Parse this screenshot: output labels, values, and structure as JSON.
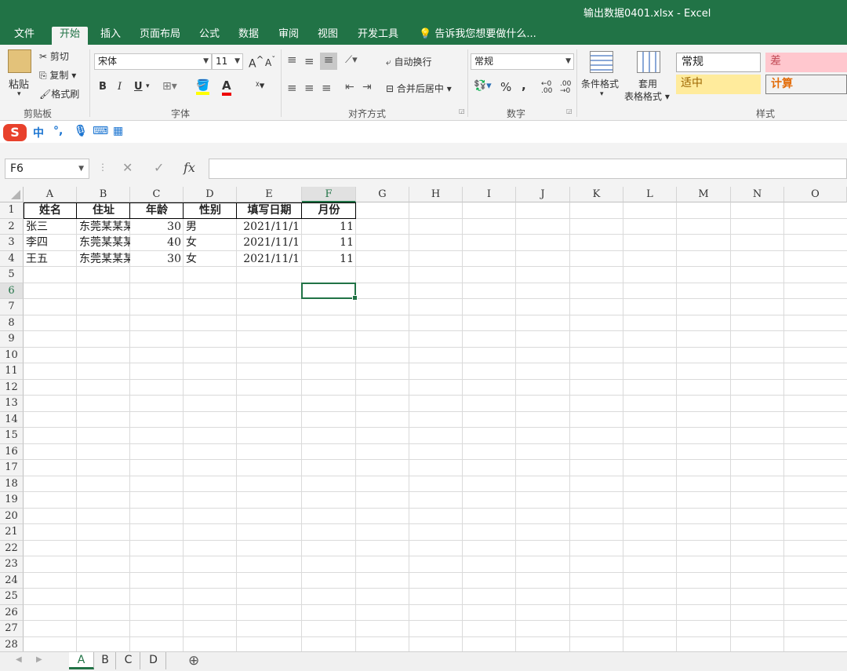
{
  "window": {
    "title": "输出数据0401.xlsx - Excel"
  },
  "tabs": [
    "文件",
    "开始",
    "插入",
    "页面布局",
    "公式",
    "数据",
    "审阅",
    "视图",
    "开发工具"
  ],
  "active_tab": "开始",
  "tell_me": "告诉我您想要做什么...",
  "ribbon": {
    "clipboard": {
      "paste": "粘贴",
      "cut": "剪切",
      "copy": "复制",
      "format_painter": "格式刷",
      "label": "剪贴板"
    },
    "font": {
      "name": "宋体",
      "size": "11",
      "bold": "B",
      "italic": "I",
      "underline": "U",
      "grow": "A",
      "shrink": "A",
      "label": "字体"
    },
    "alignment": {
      "wrap": "自动换行",
      "merge": "合并后居中",
      "label": "对齐方式"
    },
    "number": {
      "format": "常规",
      "percent": "%",
      "comma": ",",
      "label": "数字"
    },
    "styles": {
      "conditional": "条件格式",
      "table_line1": "套用",
      "table_line2": "表格格式",
      "normal": "常规",
      "bad": "差",
      "neutral": "适中",
      "calc": "计算",
      "label": "样式"
    }
  },
  "ime": {
    "logo": "S",
    "mode": "中",
    "punct": "°,"
  },
  "formula_bar": {
    "name_box": "F6",
    "fx": "fx",
    "value": ""
  },
  "columns": [
    "A",
    "B",
    "C",
    "D",
    "E",
    "F",
    "G",
    "H",
    "I",
    "J",
    "K",
    "L",
    "M",
    "N",
    "O"
  ],
  "rows": [
    "1",
    "2",
    "3",
    "4",
    "5",
    "6",
    "7",
    "8",
    "9",
    "10",
    "11",
    "12",
    "13",
    "14",
    "15",
    "16",
    "17",
    "18",
    "19",
    "20",
    "21",
    "22",
    "23",
    "24",
    "25",
    "26",
    "27",
    "28"
  ],
  "table": {
    "headers": [
      "姓名",
      "住址",
      "年龄",
      "性别",
      "填写日期",
      "月份"
    ],
    "rows": [
      [
        "张三",
        "东莞某某某",
        "30",
        "男",
        "2021/11/1",
        "11"
      ],
      [
        "李四",
        "东莞某某某",
        "40",
        "女",
        "2021/11/1",
        "11"
      ],
      [
        "王五",
        "东莞某某某",
        "30",
        "女",
        "2021/11/1",
        "11"
      ]
    ]
  },
  "selected_cell": "F6",
  "sheets": [
    "A",
    "B",
    "C",
    "D"
  ],
  "active_sheet": "A"
}
